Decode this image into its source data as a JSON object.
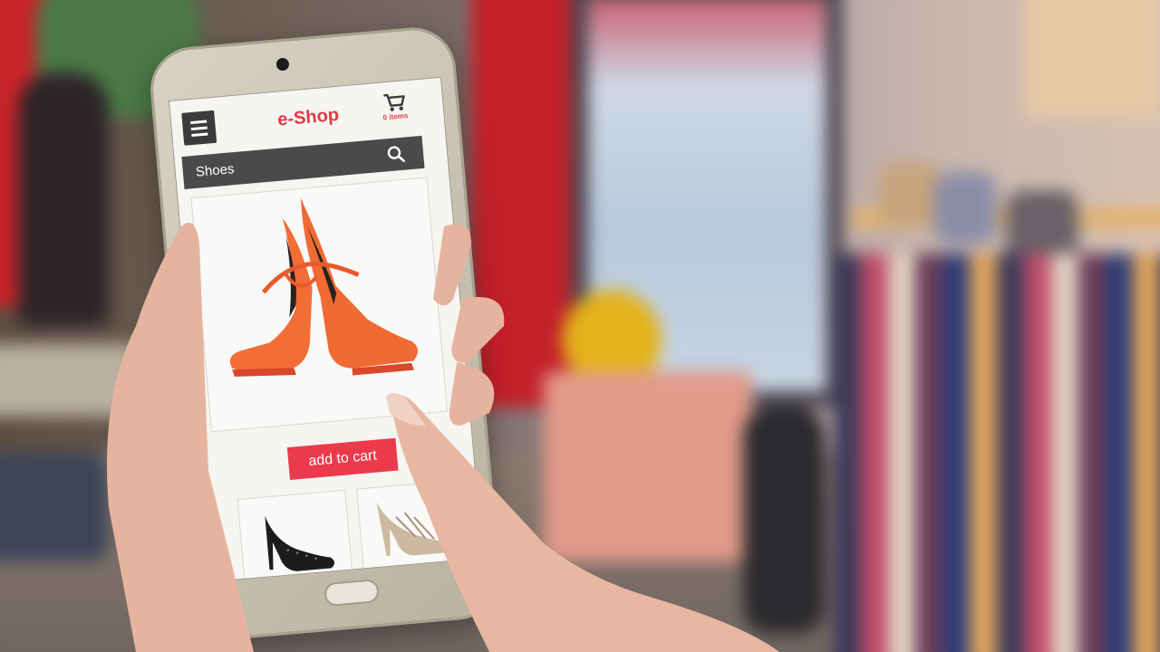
{
  "app": {
    "title": "e-Shop",
    "cart_count": "0 items"
  },
  "search": {
    "value": "Shoes"
  },
  "product": {
    "button_label": "add to cart"
  },
  "colors": {
    "accent": "#ea3a4c",
    "title": "#e23a46",
    "header_bar": "#4a4a4a",
    "shoe_main": "#f06a34"
  },
  "icons": [
    "menu-icon",
    "cart-icon",
    "search-icon"
  ]
}
